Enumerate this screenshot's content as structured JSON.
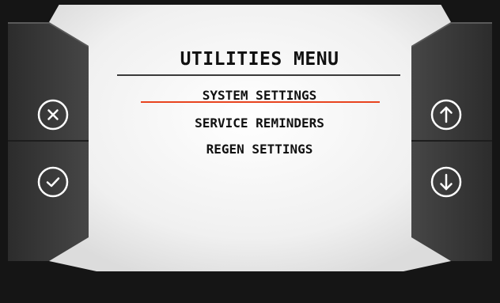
{
  "menu": {
    "title": "UTILITIES MENU",
    "items": [
      {
        "label": "SYSTEM SETTINGS",
        "selected": true
      },
      {
        "label": "SERVICE REMINDERS",
        "selected": false
      },
      {
        "label": "REGEN SETTINGS",
        "selected": false
      }
    ]
  },
  "buttons": {
    "left": [
      {
        "icon": "close-icon"
      },
      {
        "icon": "checkmark-icon"
      }
    ],
    "right": [
      {
        "icon": "arrow-up-icon"
      },
      {
        "icon": "arrow-down-icon"
      }
    ]
  },
  "colors": {
    "bezel": "#1a1a1a",
    "panel": "#3a3a3a",
    "screen": "#f2f2f2",
    "selection": "#e8441f"
  }
}
